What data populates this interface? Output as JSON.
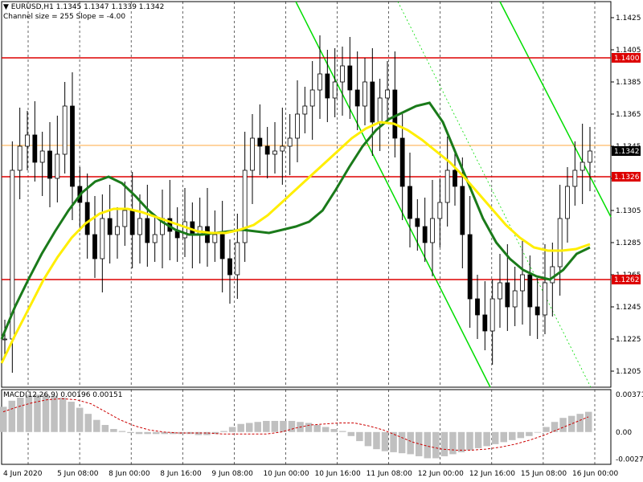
{
  "header": {
    "symbol_line": "▼ EURUSD,H1  1.1345 1.1347 1.1339 1.1342",
    "channel_line": "Channel size = 255 Slope = -4.00"
  },
  "macd_label": "MACD(12,26,9) 0.00196 0.00151",
  "chart_data": {
    "type": "candlestick",
    "symbol": "EURUSD",
    "timeframe": "H1",
    "ohlc_last": {
      "open": 1.1345,
      "high": 1.1347,
      "low": 1.1339,
      "close": 1.1342
    },
    "ylim": [
      1.1195,
      1.1435
    ],
    "y_ticks": [
      "1.1425",
      "1.1405",
      "1.1385",
      "1.1365",
      "1.1345",
      "1.1325",
      "1.1305",
      "1.1285",
      "1.1265",
      "1.1245",
      "1.1225",
      "1.1205"
    ],
    "x_ticks": [
      "4 Jun 2020",
      "5 Jun 08:00",
      "8 Jun 00:00",
      "8 Jun 16:00",
      "9 Jun 08:00",
      "10 Jun 00:00",
      "10 Jun 16:00",
      "11 Jun 08:00",
      "12 Jun 00:00",
      "12 Jun 16:00",
      "15 Jun 08:00",
      "16 Jun 00:00"
    ],
    "levels": [
      {
        "label": "1.1400",
        "value": 1.14,
        "color": "#dd0000"
      },
      {
        "label": "1.1326",
        "value": 1.1326,
        "color": "#dd0000"
      },
      {
        "label": "1.1262",
        "value": 1.1262,
        "color": "#dd0000"
      }
    ],
    "current_price": {
      "label": "1.1342",
      "value": 1.1342
    },
    "grid": true,
    "candle_close_path": [
      1.1225,
      1.133,
      1.1345,
      1.1352,
      1.1335,
      1.1342,
      1.1325,
      1.134,
      1.137,
      1.132,
      1.131,
      1.129,
      1.1275,
      1.13,
      1.129,
      1.1295,
      1.1305,
      1.129,
      1.13,
      1.1285,
      1.129,
      1.13,
      1.1292,
      1.1288,
      1.1298,
      1.129,
      1.1295,
      1.1285,
      1.129,
      1.1275,
      1.1265,
      1.1285,
      1.133,
      1.135,
      1.1345,
      1.134,
      1.1342,
      1.1345,
      1.135,
      1.1365,
      1.137,
      1.138,
      1.139,
      1.1375,
      1.1385,
      1.1395,
      1.138,
      1.137,
      1.1385,
      1.136,
      1.1375,
      1.138,
      1.135,
      1.132,
      1.13,
      1.1295,
      1.1285,
      1.13,
      1.131,
      1.133,
      1.132,
      1.129,
      1.125,
      1.124,
      1.123,
      1.125,
      1.126,
      1.1245,
      1.1255,
      1.1265,
      1.1245,
      1.124,
      1.126,
      1.127,
      1.13,
      1.132,
      1.133,
      1.1335,
      1.1342
    ],
    "series": [
      {
        "name": "",
        "color": "#1a7a1a",
        "values": [
          1.1225,
          1.1245,
          1.1262,
          1.1278,
          1.1292,
          1.1305,
          1.1316,
          1.1323,
          1.1326,
          1.1322,
          1.1314,
          1.1305,
          1.1298,
          1.1293,
          1.129,
          1.129,
          1.1291,
          1.1292,
          1.1293,
          1.1292,
          1.1291,
          1.1293,
          1.1295,
          1.1298,
          1.1305,
          1.1318,
          1.1332,
          1.1345,
          1.1355,
          1.1362,
          1.1366,
          1.137,
          1.1372,
          1.136,
          1.134,
          1.132,
          1.13,
          1.1285,
          1.1275,
          1.1268,
          1.1264,
          1.1262,
          1.1268,
          1.1278,
          1.1282
        ]
      },
      {
        "name": "",
        "color": "#ffee00",
        "values": [
          1.121,
          1.1228,
          1.1245,
          1.1262,
          1.1276,
          1.1288,
          1.1297,
          1.1303,
          1.1306,
          1.1306,
          1.1304,
          1.1301,
          1.1298,
          1.1295,
          1.1292,
          1.1291,
          1.1291,
          1.1293,
          1.1296,
          1.1302,
          1.131,
          1.1318,
          1.1326,
          1.1334,
          1.1342,
          1.135,
          1.1356,
          1.136,
          1.1359,
          1.1355,
          1.1349,
          1.1342,
          1.1335,
          1.1326,
          1.1316,
          1.1306,
          1.1296,
          1.1288,
          1.1282,
          1.128,
          1.128,
          1.1281,
          1.1284
        ]
      }
    ],
    "macd": {
      "params": "12,26,9",
      "main": 0.00196,
      "signal": 0.00151,
      "ylim": [
        -0.0032,
        0.0042
      ],
      "y_ticks": [
        "0.00371",
        "0.00",
        "-0.0027"
      ],
      "histogram": [
        0.0025,
        0.0031,
        0.0034,
        0.0036,
        0.0037,
        0.0037,
        0.0036,
        0.0034,
        0.003,
        0.0024,
        0.0018,
        0.0012,
        0.0007,
        0.0003,
        0.0001,
        -0.0001,
        -0.0002,
        -0.0002,
        -0.0002,
        -0.0002,
        -0.0002,
        -0.0002,
        -0.0002,
        -0.0003,
        -0.0003,
        -0.0002,
        0.0001,
        0.0005,
        0.0008,
        0.0009,
        0.001,
        0.0011,
        0.0011,
        0.0011,
        0.0011,
        0.001,
        0.0009,
        0.0007,
        0.0005,
        0.0003,
        0.0001,
        -0.0004,
        -0.0009,
        -0.0014,
        -0.0017,
        -0.0019,
        -0.002,
        -0.0021,
        -0.0022,
        -0.0024,
        -0.0026,
        -0.0026,
        -0.0024,
        -0.0022,
        -0.002,
        -0.0018,
        -0.0016,
        -0.0014,
        -0.0012,
        -0.001,
        -0.0008,
        -0.0006,
        -0.0004,
        0.0,
        0.0005,
        0.001,
        0.0014,
        0.0016,
        0.0018,
        0.002
      ],
      "signal_line": [
        0.002,
        0.0025,
        0.0029,
        0.0032,
        0.0033,
        0.0032,
        0.0028,
        0.002,
        0.0012,
        0.0006,
        0.0002,
        0.0,
        -0.0001,
        -0.0001,
        -0.0001,
        -0.0002,
        -0.0002,
        -0.0002,
        -0.0002,
        0.0,
        0.0004,
        0.0007,
        0.0008,
        0.0009,
        0.0009,
        0.0006,
        0.0002,
        -0.0004,
        -0.001,
        -0.0014,
        -0.0017,
        -0.0018,
        -0.0018,
        -0.0017,
        -0.0015,
        -0.0012,
        -0.0008,
        -0.0003,
        0.0003,
        0.0009,
        0.0015
      ]
    }
  }
}
